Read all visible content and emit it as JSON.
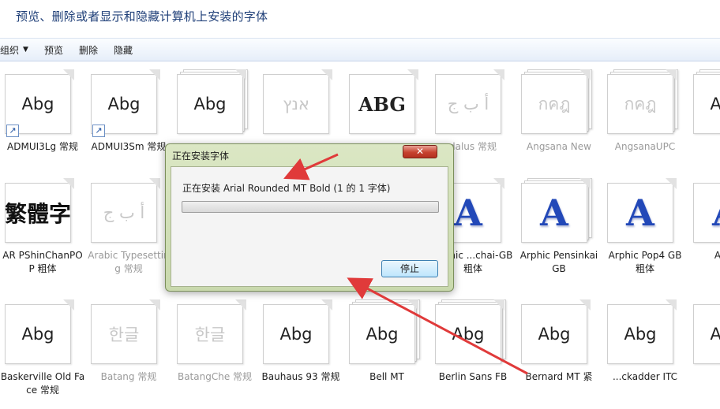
{
  "window": {
    "title": "预览、删除或者显示和隐藏计算机上安装的字体"
  },
  "toolbar": {
    "organize_label": "组织",
    "preview_label": "预览",
    "delete_label": "删除",
    "hide_label": "隐藏"
  },
  "fonts": [
    {
      "label": "ADMUI3Lg 常规",
      "sample": "Abg",
      "faded": false,
      "shortcut": true,
      "stacked": false
    },
    {
      "label": "ADMUI3Sm 常规",
      "sample": "Abg",
      "faded": false,
      "shortcut": true,
      "stacked": false
    },
    {
      "label": "",
      "sample": "Abg",
      "faded": false,
      "shortcut": false,
      "stacked": true
    },
    {
      "label": "",
      "sample": "אנץ",
      "faded": true,
      "shortcut": false,
      "stacked": false
    },
    {
      "label": "",
      "sample": "ABG",
      "faded": false,
      "shortcut": false,
      "stacked": false
    },
    {
      "label": "dalus 常规",
      "sample": "أ ب ج",
      "faded": true,
      "shortcut": false,
      "stacked": false
    },
    {
      "label": "Angsana New",
      "sample": "กคฎ",
      "faded": true,
      "shortcut": false,
      "stacked": true
    },
    {
      "label": "AngsanaUPC",
      "sample": "กคฎ",
      "faded": true,
      "shortcut": false,
      "stacked": true
    },
    {
      "label": "Ap",
      "sample": "Abg",
      "faded": false,
      "shortcut": false,
      "stacked": true
    },
    {
      "label": "AR PShinChanPOP 粗体",
      "sample": "繁體字",
      "faded": false,
      "shortcut": false,
      "stacked": false
    },
    {
      "label": "Arabic Typesetting 常规",
      "sample": "أ ب ج",
      "faded": true,
      "shortcut": false,
      "stacked": false
    },
    {
      "label": "",
      "sample": "",
      "faded": false,
      "shortcut": false,
      "stacked": false
    },
    {
      "label": "",
      "sample": "",
      "faded": false,
      "shortcut": false,
      "stacked": false
    },
    {
      "label": "",
      "sample": "",
      "faded": false,
      "shortcut": false,
      "stacked": false
    },
    {
      "label": "Arphic ...chai-GB 粗体",
      "sample": "A",
      "faded": false,
      "shortcut": false,
      "stacked": false
    },
    {
      "label": "Arphic Pensinkai GB",
      "sample": "A",
      "faded": false,
      "shortcut": false,
      "stacked": true
    },
    {
      "label": "Arphic Pop4 GB 粗体",
      "sample": "A",
      "faded": false,
      "shortcut": false,
      "stacked": false
    },
    {
      "label": "A Shue",
      "sample": "A",
      "faded": false,
      "shortcut": false,
      "stacked": false
    },
    {
      "label": "Baskerville Old Face 常规",
      "sample": "Abg",
      "faded": false,
      "shortcut": false,
      "stacked": false
    },
    {
      "label": "Batang 常规",
      "sample": "한글",
      "faded": true,
      "shortcut": false,
      "stacked": false
    },
    {
      "label": "BatangChe 常规",
      "sample": "한글",
      "faded": true,
      "shortcut": false,
      "stacked": false
    },
    {
      "label": "Bauhaus 93 常规",
      "sample": "Abg",
      "faded": false,
      "shortcut": false,
      "stacked": false
    },
    {
      "label": "Bell MT",
      "sample": "Abg",
      "faded": false,
      "shortcut": false,
      "stacked": true
    },
    {
      "label": "Berlin Sans FB",
      "sample": "Abg",
      "faded": false,
      "shortcut": false,
      "stacked": true
    },
    {
      "label": "Bernard MT 紧",
      "sample": "Abg",
      "faded": false,
      "shortcut": false,
      "stacked": false
    },
    {
      "label": "...ckadder ITC",
      "sample": "Abg",
      "faded": false,
      "shortcut": false,
      "stacked": false
    },
    {
      "label": "Boo",
      "sample": "Abg",
      "faded": false,
      "shortcut": false,
      "stacked": false
    }
  ],
  "dialog": {
    "title": "正在安装字体",
    "close_label": "✕",
    "status": "正在安装 Arial Rounded MT Bold (1 的 1 字体)",
    "progress_percent": 0,
    "stop_label": "停止"
  },
  "annotation_color": "#e03a3a"
}
